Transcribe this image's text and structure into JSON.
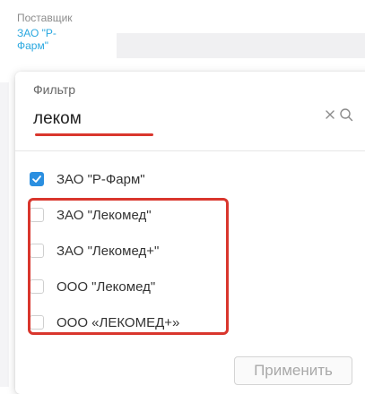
{
  "background": {
    "column_title": "Поставщик",
    "column_value": "ЗАО \"Р-Фарм\""
  },
  "filter": {
    "label": "Фильтр",
    "value": "леком",
    "clear_icon": "close-icon",
    "search_icon": "search-icon"
  },
  "options": [
    {
      "label": "ЗАО \"Р-Фарм\"",
      "checked": true
    },
    {
      "label": "ЗАО \"Лекомед\"",
      "checked": false
    },
    {
      "label": "ЗАО \"Лекомед+\"",
      "checked": false
    },
    {
      "label": "ООО \"Лекомед\"",
      "checked": false
    },
    {
      "label": "ООО «ЛЕКОМЕД+»",
      "checked": false
    }
  ],
  "apply_button": {
    "label": "Применить",
    "disabled": true
  },
  "colors": {
    "accent": "#2b8fe0",
    "link": "#2aa8e0",
    "annotation": "#d9362d"
  }
}
